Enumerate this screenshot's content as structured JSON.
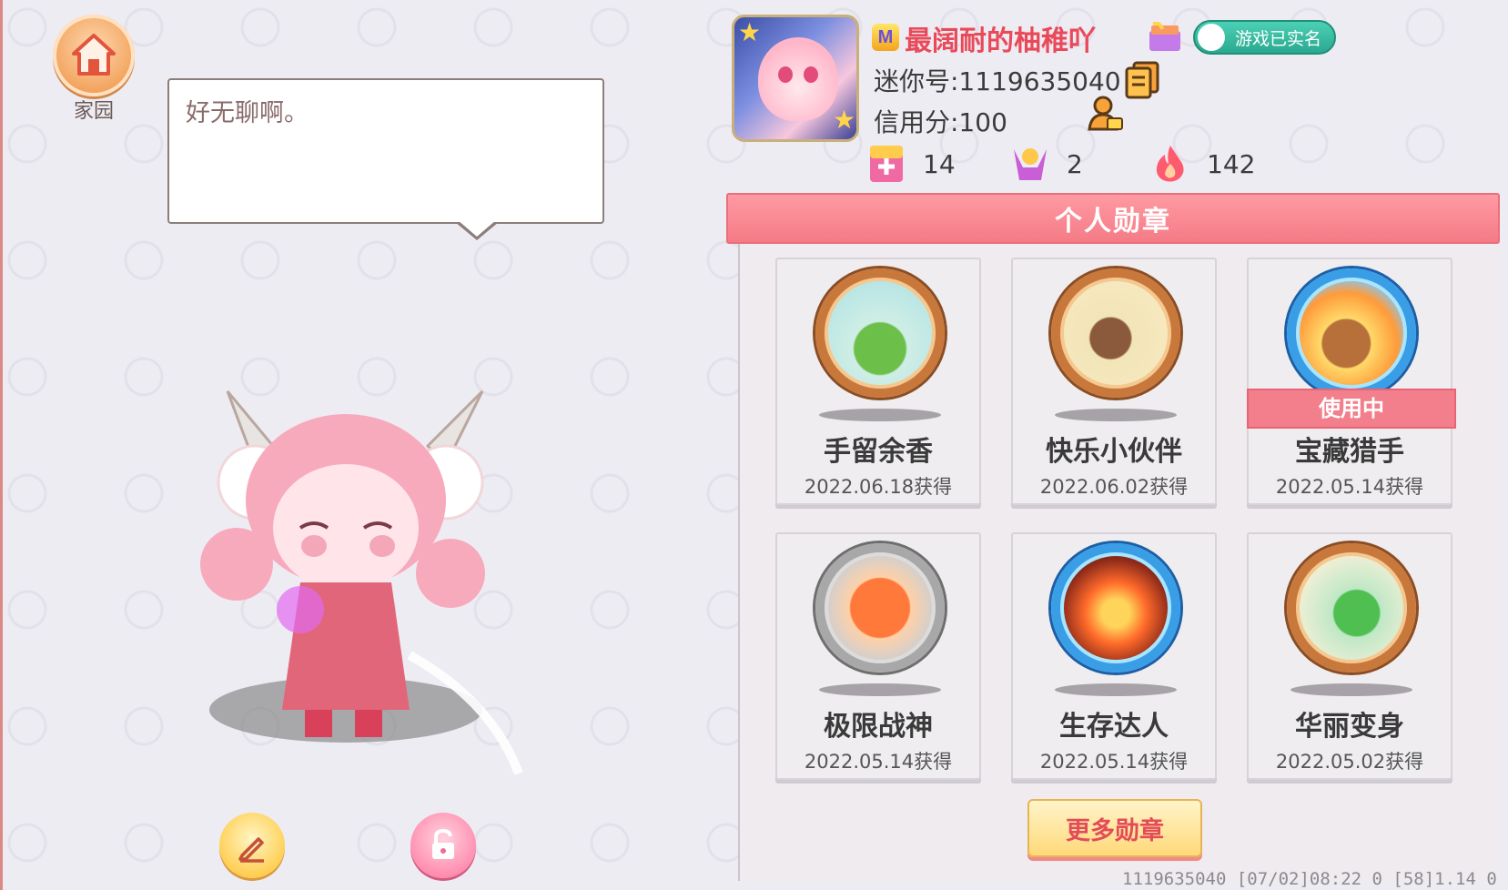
{
  "home": {
    "label": "家园"
  },
  "bubble": {
    "text": "好无聊啊。"
  },
  "profile": {
    "nickname": "最阔耐的柚稚吖",
    "realname_badge": "游戏已实名",
    "mini_id": "迷你号:1119635040",
    "credit": "信用分:100",
    "stats": [
      {
        "icon": "plus-card-icon",
        "value": "14"
      },
      {
        "icon": "fans-icon",
        "value": "2"
      },
      {
        "icon": "flame-icon",
        "value": "142"
      }
    ]
  },
  "medals": {
    "title": "个人勋章",
    "in_use_label": "使用中",
    "items": [
      {
        "name": "手留余香",
        "date": "2022.06.18获得",
        "icon": "frog-medal-icon"
      },
      {
        "name": "快乐小伙伴",
        "date": "2022.06.02获得",
        "icon": "friends-medal-icon"
      },
      {
        "name": "宝藏猎手",
        "date": "2022.05.14获得",
        "icon": "treasure-medal-icon"
      },
      {
        "name": "极限战神",
        "date": "2022.05.14获得",
        "icon": "boss-medal-icon"
      },
      {
        "name": "生存达人",
        "date": "2022.05.14获得",
        "icon": "fire-medal-icon"
      },
      {
        "name": "华丽变身",
        "date": "2022.05.02获得",
        "icon": "dino-medal-icon"
      }
    ],
    "more_label": "更多勋章"
  },
  "footer": {
    "text": "1119635040    [07/02]08:22 0    [58]1.14 0"
  },
  "colors": {
    "accent": "#f47b86",
    "nickname": "#e94a5a",
    "gold": "#ffd97a"
  }
}
